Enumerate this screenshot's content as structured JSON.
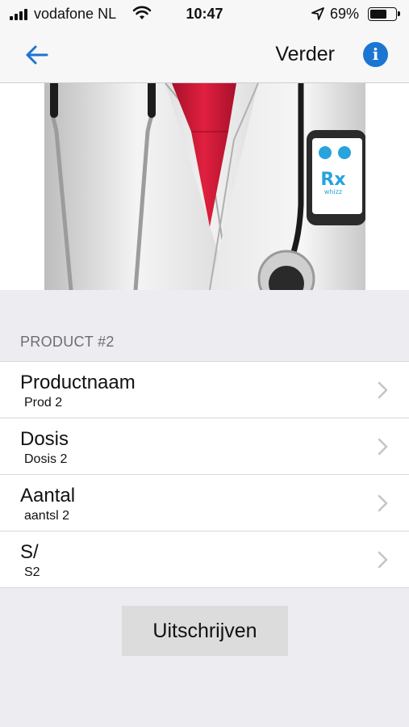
{
  "status_bar": {
    "carrier": "vodafone NL",
    "time": "10:47",
    "battery_percent": "69%",
    "battery_level": 0.69,
    "icons": [
      "signal-icon",
      "wifi-icon",
      "location-arrow-icon",
      "battery-icon"
    ]
  },
  "nav": {
    "back_icon": "back-arrow-icon",
    "action_label": "Verder",
    "info_icon": "info-icon",
    "info_glyph": "i",
    "accent_color": "#1a76d2"
  },
  "hero": {
    "phone_logo_text": "Rx",
    "phone_logo_subtext": "whizz"
  },
  "section": {
    "header": "PRODUCT #2",
    "items": [
      {
        "title": "Productnaam",
        "value": "Prod 2"
      },
      {
        "title": "Dosis",
        "value": "Dosis 2"
      },
      {
        "title": "Aantal",
        "value": "aantsl 2"
      },
      {
        "title": "S/",
        "value": "S2"
      }
    ]
  },
  "actions": {
    "submit_label": "Uitschrijven"
  }
}
